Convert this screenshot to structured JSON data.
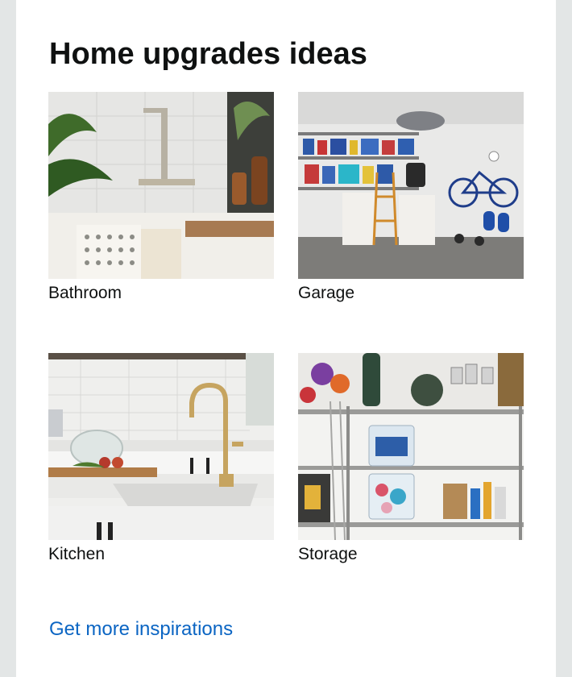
{
  "card": {
    "title": "Home upgrades ideas",
    "tiles": [
      {
        "label": "Bathroom"
      },
      {
        "label": "Garage"
      },
      {
        "label": "Kitchen"
      },
      {
        "label": "Storage"
      }
    ],
    "more_link": "Get more inspirations"
  },
  "colors": {
    "page_bg": "#e3e6e6",
    "card_bg": "#ffffff",
    "text": "#0f1111",
    "link": "#0b65c3"
  }
}
